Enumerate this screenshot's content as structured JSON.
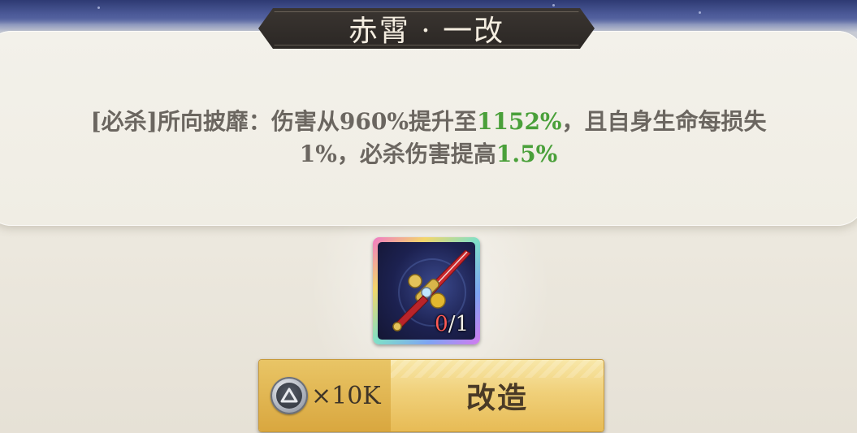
{
  "title": "赤霄 · 一改",
  "description": {
    "line1_prefix": "[必杀]所向披靡：伤害从960%提升至",
    "line1_highlight": "1152%",
    "line1_suffix": "，且自身生命每损失",
    "line2_prefix": "1%，必杀伤害提高",
    "line2_highlight": "1.5%"
  },
  "material": {
    "icon": "red-sword-icon",
    "count_current": "0",
    "count_separator": "/",
    "count_required": "1"
  },
  "upgrade_button": {
    "currency_icon": "silver-coin-icon",
    "cost": "×10K",
    "label": "改造"
  },
  "colors": {
    "highlight": "#4aa03a",
    "insufficient": "#ff5a55",
    "button_gold": "#f0d07a"
  }
}
